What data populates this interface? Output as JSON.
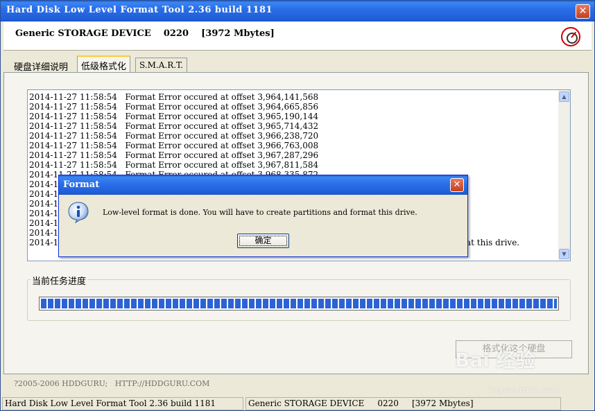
{
  "window": {
    "title": "Hard Disk Low Level Format Tool 2.36 build 1181",
    "close_glyph": "✕"
  },
  "header": {
    "device_info": "Generic STORAGE DEVICE    0220    [3972 Mbytes]",
    "logo_icon": "hddguru-gauge-icon"
  },
  "tabs": [
    {
      "label": "硬盘详细说明",
      "active": false
    },
    {
      "label": "低级格式化",
      "active": true
    },
    {
      "label": "S.M.A.R.T.",
      "active": false
    }
  ],
  "log": {
    "lines": [
      "2014-11-27 11:58:54   Format Error occured at offset 3,964,141,568",
      "2014-11-27 11:58:54   Format Error occured at offset 3,964,665,856",
      "2014-11-27 11:58:54   Format Error occured at offset 3,965,190,144",
      "2014-11-27 11:58:54   Format Error occured at offset 3,965,714,432",
      "2014-11-27 11:58:54   Format Error occured at offset 3,966,238,720",
      "2014-11-27 11:58:54   Format Error occured at offset 3,966,763,008",
      "2014-11-27 11:58:54   Format Error occured at offset 3,967,287,296",
      "2014-11-27 11:58:54   Format Error occured at offset 3,967,811,584",
      "2014-11-27 11:58:54   Format Error occured at offset 3,968,335,872",
      "2014-1",
      "2014-1",
      "2014-1",
      "2014-1",
      "2014-1",
      "2014-1",
      "2014-1"
    ],
    "last_line_tail": "at this drive.",
    "scroll_up": "▲",
    "scroll_down": "▼"
  },
  "progress": {
    "label": "当前任务进度",
    "value_fraction": 1.0
  },
  "format_button": {
    "label": "格式化这个硬盘",
    "enabled": false
  },
  "footer": {
    "copyright": "?2005-2006 HDDGURU;   HTTP://HDDGURU.COM"
  },
  "statusbar": {
    "pane1": "Hard Disk Low Level Format Tool 2.36 build 1181",
    "pane2": "Generic STORAGE DEVICE     0220     [3972 Mbytes]"
  },
  "dialog": {
    "title": "Format",
    "icon": "info-icon",
    "message": "Low-level format is done. You will have to create partitions and format this drive.",
    "ok_label": "确定",
    "close_glyph": "✕"
  },
  "watermark": {
    "text": "Bai 经验",
    "sub": "jingyan.baidu.com"
  }
}
